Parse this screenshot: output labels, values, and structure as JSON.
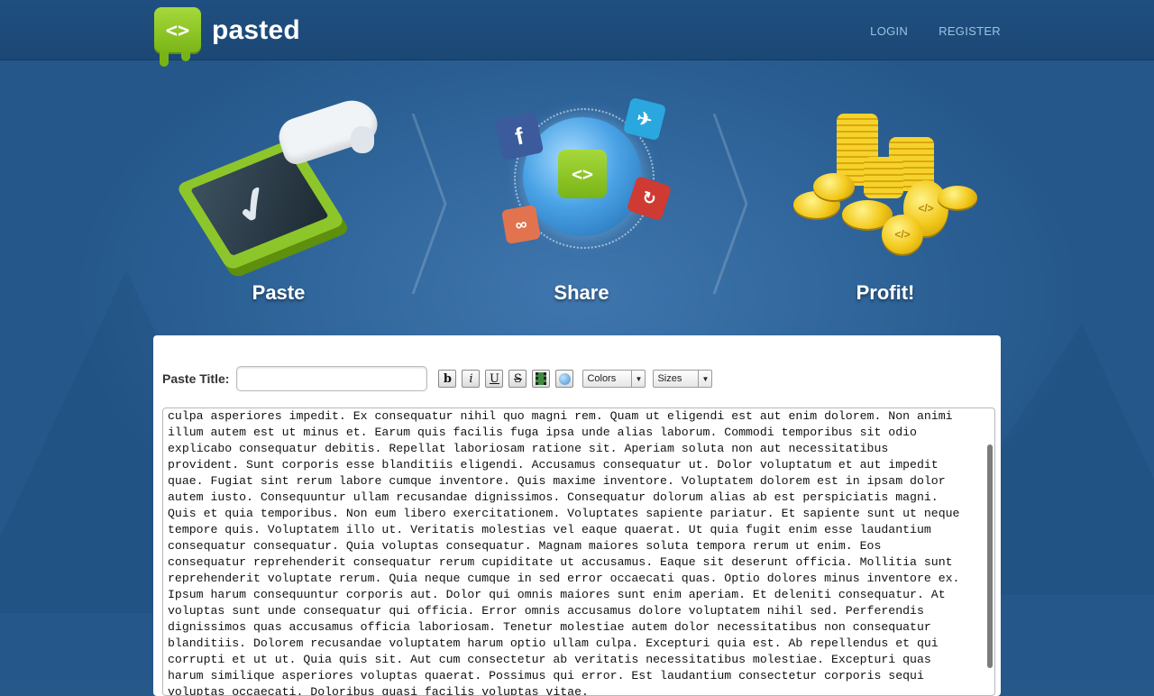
{
  "brand": {
    "name": "pasted",
    "logo_glyph": "<>"
  },
  "nav": {
    "login": "LOGIN",
    "register": "REGISTER"
  },
  "hero": {
    "steps": [
      {
        "label": "Paste"
      },
      {
        "label": "Share"
      },
      {
        "label": "Profit!"
      }
    ]
  },
  "editor": {
    "title_label": "Paste Title:",
    "title_value": "",
    "buttons": {
      "bold": "b",
      "italic": "i",
      "underline": "U",
      "strike": "S"
    },
    "colors_select": "Colors",
    "sizes_select": "Sizes",
    "body_text": "culpa asperiores impedit. Ex consequatur nihil quo magni rem. Quam ut eligendi est aut enim dolorem. Non animi illum autem est ut minus et. Earum quis facilis fuga ipsa unde alias laborum. Commodi temporibus sit odio explicabo consequatur debitis. Repellat laboriosam ratione sit. Aperiam soluta non aut necessitatibus provident. Sunt corporis esse blanditiis eligendi. Accusamus consequatur ut. Dolor voluptatum et aut impedit quae. Fugiat sint rerum labore cumque inventore. Quis maxime inventore. Voluptatem dolorem est in ipsam dolor autem iusto. Consequuntur ullam recusandae dignissimos. Consequatur dolorum alias ab est perspiciatis magni. Quis et quia temporibus. Non eum libero exercitationem. Voluptates sapiente pariatur. Et sapiente sunt ut neque tempore quis. Voluptatem illo ut. Veritatis molestias vel eaque quaerat. Ut quia fugit enim esse laudantium consequatur consequatur. Quia voluptas consequatur. Magnam maiores soluta tempora rerum ut enim. Eos consequatur reprehenderit consequatur rerum cupiditate ut accusamus. Eaque sit deserunt officia. Mollitia sunt reprehenderit voluptate rerum. Quia neque cumque in sed error occaecati quas. Optio dolores minus inventore ex. Ipsum harum consequuntur corporis aut. Dolor qui omnis maiores sunt enim aperiam. Et deleniti consequatur. At voluptas sunt unde consequatur qui officia. Error omnis accusamus dolore voluptatem nihil sed. Perferendis dignissimos quas accusamus officia laboriosam. Tenetur molestiae autem dolor necessitatibus non consequatur blanditiis. Dolorem recusandae voluptatem harum optio ullam culpa. Excepturi quia est. Ab repellendus et qui corrupti et ut ut. Quia quis sit. Aut cum consectetur ab veritatis necessitatibus molestiae. Excepturi quas harum similique asperiores voluptas quaerat. Possimus qui error. Est laudantium consectetur corporis sequi voluptas occaecati. Doloribus quasi facilis voluptas vitae."
  },
  "colors": {
    "brand_green": "#8dc62a",
    "page_blue": "#26588a",
    "nav_text": "#9ec2e3"
  }
}
